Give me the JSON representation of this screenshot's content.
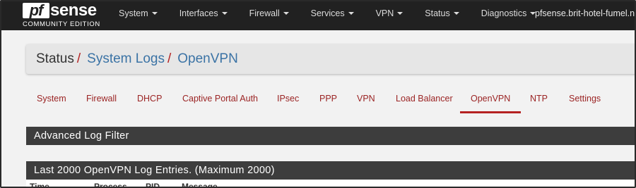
{
  "brand": {
    "logo_pf": "pf",
    "logo_sense": "sense",
    "edition": "COMMUNITY EDITION"
  },
  "navbar": {
    "items": [
      {
        "label": "System"
      },
      {
        "label": "Interfaces"
      },
      {
        "label": "Firewall"
      },
      {
        "label": "Services"
      },
      {
        "label": "VPN"
      },
      {
        "label": "Status"
      },
      {
        "label": "Diagnostics"
      }
    ],
    "hostname": "pfsense.brit-hotel-fumel.ne"
  },
  "breadcrumb": {
    "root": "Status",
    "separator": "/",
    "items": [
      "System Logs",
      "OpenVPN"
    ]
  },
  "tabs": {
    "items": [
      {
        "label": "System"
      },
      {
        "label": "Firewall"
      },
      {
        "label": "DHCP"
      },
      {
        "label": "Captive Portal Auth"
      },
      {
        "label": "IPsec"
      },
      {
        "label": "PPP"
      },
      {
        "label": "VPN"
      },
      {
        "label": "Load Balancer"
      },
      {
        "label": "OpenVPN",
        "active": true
      },
      {
        "label": "NTP"
      },
      {
        "label": "Settings"
      }
    ]
  },
  "panels": {
    "filter_title": "Advanced Log Filter",
    "entries_title": "Last 2000 OpenVPN Log Entries. (Maximum 2000)"
  },
  "table": {
    "columns": [
      "Time",
      "Process",
      "PID",
      "Message"
    ]
  },
  "colors": {
    "navbar_bg": "#212121",
    "accent_red": "#b52222",
    "link_blue": "#3b73a5",
    "panel_heading_bg": "#3d3d3d"
  }
}
